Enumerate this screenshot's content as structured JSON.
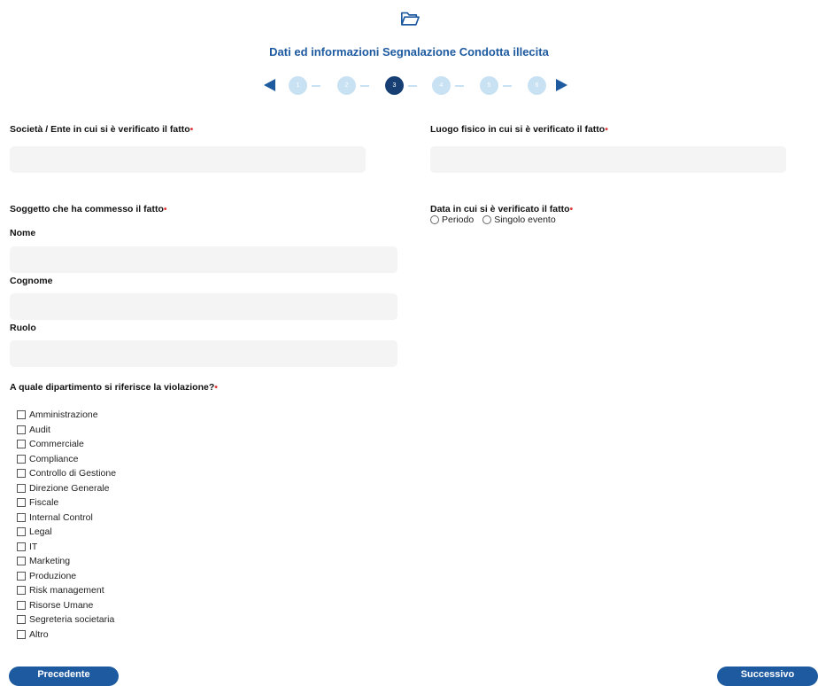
{
  "header": {
    "title": "Dati ed informazioni Segnalazione Condotta illecita",
    "icon": "folder-icon",
    "accent_color": "#1e5aa0"
  },
  "stepper": {
    "steps": [
      "1",
      "2",
      "3",
      "4",
      "5",
      "6"
    ],
    "current": "3"
  },
  "form": {
    "societa_label": "Società / Ente in cui si è verificato il fatto",
    "luogo_label": "Luogo fisico in cui si è verificato il fatto",
    "soggetto_label": "Soggetto che ha commesso il fatto",
    "nome_label": "Nome",
    "cognome_label": "Cognome",
    "ruolo_label": "Ruolo",
    "data_label": "Data in cui si è verificato il fatto",
    "data_options": [
      "Periodo",
      "Singolo evento"
    ],
    "dipartimento_label": "A quale dipartimento si riferisce la violazione?",
    "required_mark": "•",
    "departments": [
      "Amministrazione",
      "Audit",
      "Commerciale",
      "Compliance",
      "Controllo di Gestione",
      "Direzione Generale",
      "Fiscale",
      "Internal Control",
      "Legal",
      "IT",
      "Marketing",
      "Produzione",
      "Risk management",
      "Risorse Umane",
      "Segreteria societaria",
      "Altro"
    ]
  },
  "buttons": {
    "prev": "Precedente",
    "next": "Successivo"
  }
}
